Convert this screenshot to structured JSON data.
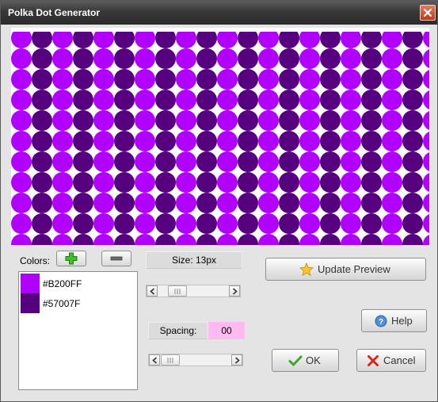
{
  "window": {
    "title": "Polka Dot Generator",
    "close_icon": "close-icon"
  },
  "preview": {
    "colors": [
      "#B200FF",
      "#57007F"
    ],
    "dot_size_px": 13,
    "spacing": "00"
  },
  "colors_panel": {
    "label": "Colors:",
    "add_icon": "plus-icon",
    "remove_icon": "minus-icon",
    "items": [
      {
        "label": "#B200FF",
        "color": "#B200FF"
      },
      {
        "label": "#57007F",
        "color": "#57007F"
      }
    ]
  },
  "size": {
    "label": "Size: 13px",
    "slider_position": 0.22
  },
  "spacing": {
    "label": "Spacing:",
    "value": "00",
    "slider_position": 0.12
  },
  "buttons": {
    "update_preview": "Update Preview",
    "help": "Help",
    "ok": "OK",
    "cancel": "Cancel"
  }
}
